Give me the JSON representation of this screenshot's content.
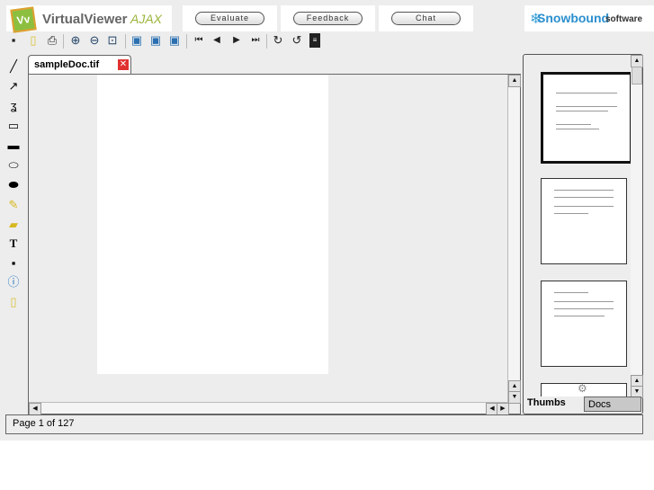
{
  "header": {
    "logo_text": "VirtualViewer",
    "logo_suffix": "AJAX",
    "buttons": [
      "Evaluate",
      "Feedback",
      "Chat"
    ],
    "brand": "Snowbound",
    "brand_suffix": "software"
  },
  "toolbar": [
    "save-icon",
    "new-note-icon",
    "print-icon",
    "zoom-in-icon",
    "zoom-out-icon",
    "zoom-rect-icon",
    "fit-page-icon",
    "fit-height-icon",
    "fit-width-icon",
    "first-page-icon",
    "prev-page-icon",
    "next-page-icon",
    "last-page-icon",
    "rotate-cw-icon",
    "rotate-ccw-icon",
    "page-manipulation-icon"
  ],
  "annotations": [
    "line",
    "arrow",
    "freehand",
    "rectangle",
    "filled-rectangle",
    "ellipse",
    "filled-ellipse",
    "highlighter",
    "sticky-note",
    "text",
    "save-annotations",
    "annotation-info",
    "note-page"
  ],
  "document": {
    "tab_label": "sampleDoc.tif"
  },
  "panel": {
    "tabs": [
      "Thumbs",
      "Docs"
    ],
    "active_tab": "Thumbs"
  },
  "status": {
    "text": "Page 1 of 127"
  }
}
